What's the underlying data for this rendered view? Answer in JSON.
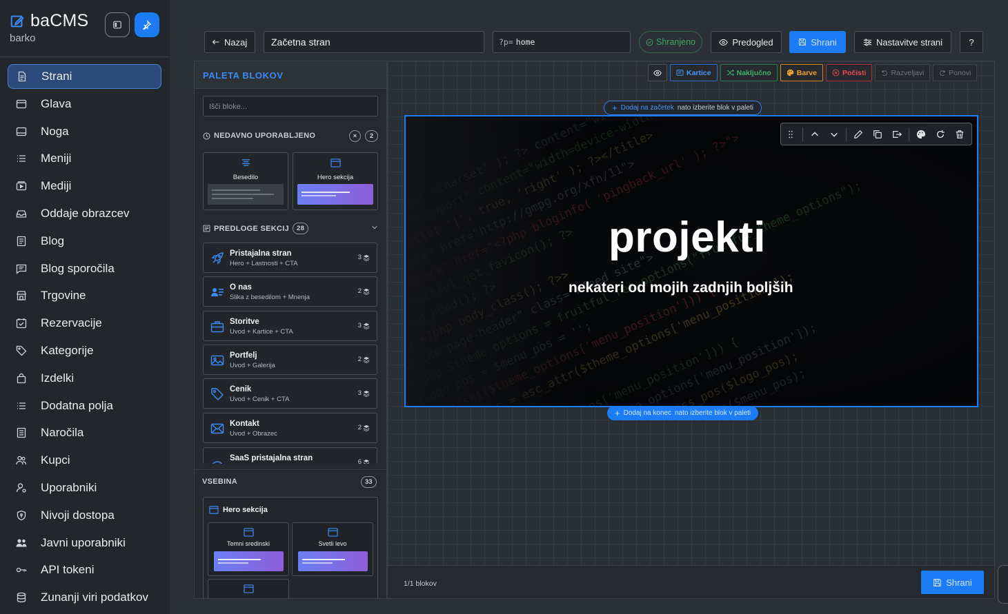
{
  "brand": {
    "title": "baCMS",
    "subtitle": "barko"
  },
  "sidebar": {
    "items": [
      {
        "label": "Strani",
        "icon": "document-icon",
        "active": true
      },
      {
        "label": "Glava",
        "icon": "header-icon"
      },
      {
        "label": "Noga",
        "icon": "footer-icon"
      },
      {
        "label": "Meniji",
        "icon": "list-icon"
      },
      {
        "label": "Mediji",
        "icon": "media-icon"
      },
      {
        "label": "Oddaje obrazcev",
        "icon": "inbox-icon"
      },
      {
        "label": "Blog",
        "icon": "blog-icon"
      },
      {
        "label": "Blog sporočila",
        "icon": "message-icon"
      },
      {
        "label": "Trgovine",
        "icon": "store-icon"
      },
      {
        "label": "Rezervacije",
        "icon": "calendar-check-icon"
      },
      {
        "label": "Kategorije",
        "icon": "tag-icon"
      },
      {
        "label": "Izdelki",
        "icon": "bag-icon"
      },
      {
        "label": "Dodatna polja",
        "icon": "list-icon"
      },
      {
        "label": "Naročila",
        "icon": "receipt-icon"
      },
      {
        "label": "Kupci",
        "icon": "users-icon"
      },
      {
        "label": "Uporabniki",
        "icon": "user-gear-icon"
      },
      {
        "label": "Nivoji dostopa",
        "icon": "shield-icon"
      },
      {
        "label": "Javni uporabniki",
        "icon": "people-icon"
      },
      {
        "label": "API tokeni",
        "icon": "key-icon"
      },
      {
        "label": "Zunanji viri podatkov",
        "icon": "database-icon"
      }
    ]
  },
  "topbar": {
    "back_label": "Nazaj",
    "page_title": "Začetna stran",
    "slug_prefix": "?p=",
    "slug_value": "home",
    "status_label": "Shranjeno",
    "preview_label": "Predogled",
    "save_label": "Shrani",
    "settings_label": "Nastavitve strani",
    "help_label": "?"
  },
  "palette": {
    "title": "PALETA BLOKOV",
    "search_placeholder": "Išči bloke...",
    "recent": {
      "label": "NEDAVNO UPORABLJENO",
      "count": "2",
      "clear_glyph": "×",
      "items": [
        {
          "label": "Besedilo",
          "icon": "text-align-icon"
        },
        {
          "label": "Hero sekcija",
          "icon": "window-icon"
        }
      ]
    },
    "templates": {
      "label": "PREDLOGE SEKCIJ",
      "count": "28",
      "items": [
        {
          "name": "Pristajalna stran",
          "desc": "Hero + Lastnosti + CTA",
          "count": "3",
          "icon": "rocket-icon"
        },
        {
          "name": "O nas",
          "desc": "Slika z besedilom + Mnenja",
          "count": "2",
          "icon": "user-card-icon"
        },
        {
          "name": "Storitve",
          "desc": "Uvod + Kartice + CTA",
          "count": "3",
          "icon": "briefcase-icon"
        },
        {
          "name": "Portfelj",
          "desc": "Uvod + Galerija",
          "count": "2",
          "icon": "image-icon"
        },
        {
          "name": "Cenik",
          "desc": "Uvod + Cenik + CTA",
          "count": "3",
          "icon": "price-tag-icon"
        },
        {
          "name": "Kontakt",
          "desc": "Uvod + Obrazec",
          "count": "2",
          "icon": "envelope-icon"
        },
        {
          "name": "SaaS pristajalna stran",
          "desc": "",
          "count": "6",
          "icon": "gauge-icon"
        }
      ]
    },
    "content": {
      "label": "VSEBINA",
      "count": "33",
      "group_title": "Hero sekcija",
      "items": [
        {
          "label": "Temni sredinski"
        },
        {
          "label": "Svetli levo"
        }
      ]
    }
  },
  "canvas": {
    "toolbar": {
      "cards_label": "Kartice",
      "random_label": "Naključno",
      "colors_label": "Barve",
      "clear_label": "Počisti",
      "undo_label": "Razveljavi",
      "redo_label": "Ponovi"
    },
    "add_top": {
      "action": "Dodaj na začetek",
      "hint": "nato izberite blok v paleti"
    },
    "add_bottom": {
      "action": "Dodaj na konec",
      "hint": "nato izberite blok v paleti"
    },
    "hero": {
      "title": "projekti",
      "subtitle": "nekateri od mojih zadnjih boljših"
    },
    "footer": {
      "count_label": "1/1 blokov",
      "save_label": "Shrani"
    }
  },
  "colors": {
    "accent": "#1b7cf5",
    "success": "#3fa665",
    "warning": "#f0a02e",
    "danger": "#e84a55"
  }
}
